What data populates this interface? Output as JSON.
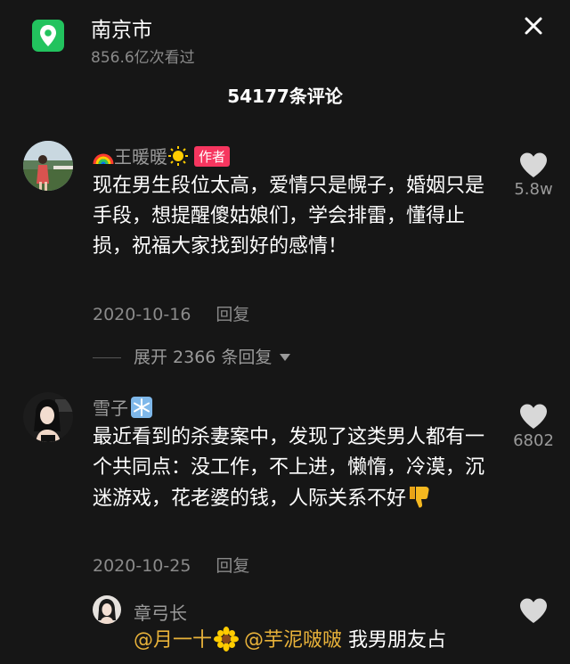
{
  "header": {
    "location_name": "南京市",
    "views": "856.6亿次看过"
  },
  "comments_count": "54177条评论",
  "comments": [
    {
      "username": "王暖暖",
      "badge": "作者",
      "text": "现在男生段位太高，爱情只是幌子，婚姻只是手段，想提醒傻姑娘们，学会排雷，懂得止损，祝福大家找到好的感情！",
      "date": "2020-10-16",
      "reply_label": "回复",
      "likes": "5.8w",
      "expand_replies": "展开 2366 条回复"
    },
    {
      "username": "雪子",
      "text": "最近看到的杀妻案中，发现了这类男人都有一个共同点：没工作，不上进，懒惰，冷漠，沉迷游戏，花老婆的钱，人际关系不好",
      "date": "2020-10-25",
      "reply_label": "回复",
      "likes": "6802"
    },
    {
      "username": "章弓长",
      "mention1": "@月一十",
      "mention2": "@芋泥啵啵",
      "text": "我男朋友占"
    }
  ],
  "colors": {
    "accent": "#f6365f",
    "location_green": "#22c35e",
    "mention": "#e8b23a",
    "background": "#161616"
  },
  "icons": [
    "location-pin-icon",
    "close-icon",
    "rainbow-emoji-icon",
    "sun-emoji-icon",
    "snowflake-emoji-icon",
    "thumbs-down-emoji-icon",
    "sunflower-emoji-icon",
    "heart-icon",
    "caret-down-icon"
  ]
}
